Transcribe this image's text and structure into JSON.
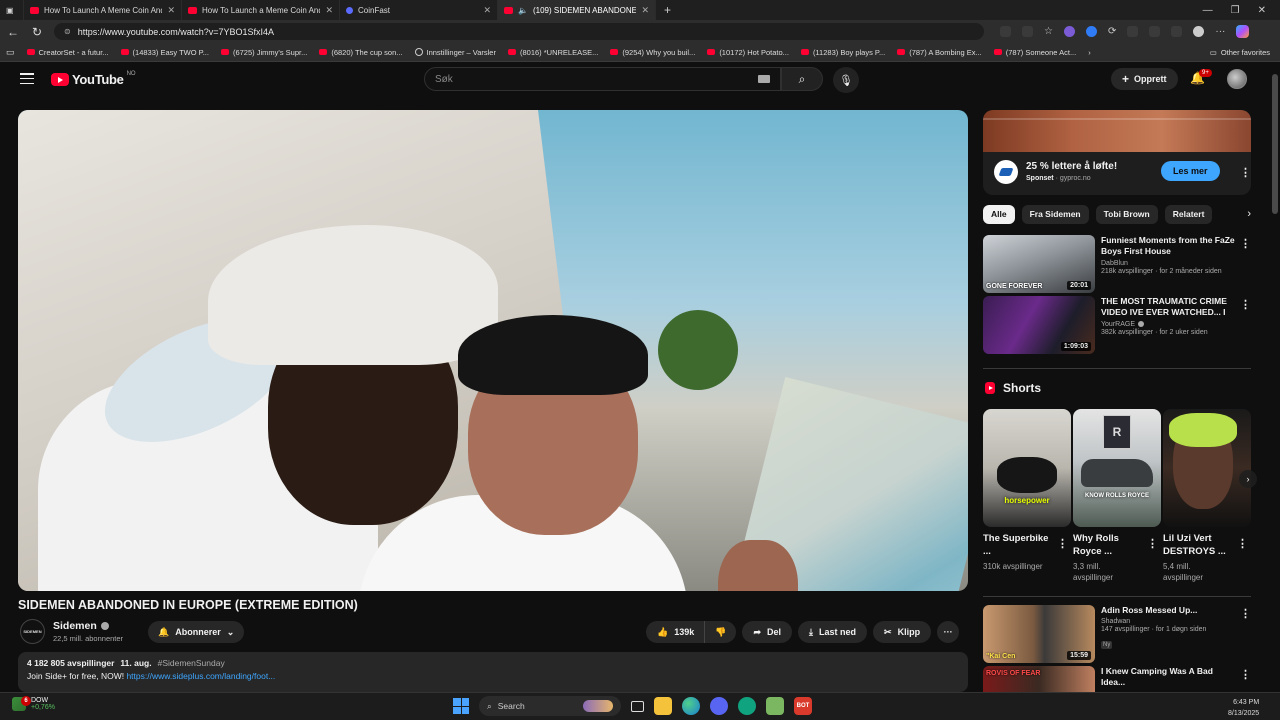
{
  "browser": {
    "tabs": [
      {
        "title": "How To Launch A Meme Coin And",
        "icon": "youtube-icon",
        "active": false
      },
      {
        "title": "How To Launch a Meme Coin And",
        "icon": "youtube-icon",
        "active": false
      },
      {
        "title": "CoinFast",
        "icon": "coinfast-icon",
        "active": false
      },
      {
        "title": "(109) SIDEMEN ABANDONED",
        "icon": "youtube-icon",
        "active": true
      }
    ],
    "url": "https://www.youtube.com/watch?v=7YBO1SfxI4A",
    "bookmarks": [
      "CreatorSet - a futur...",
      "(14833) Easy TWO P...",
      "(6725) Jimmy's Supr...",
      "(6820) The cup son...",
      "Innstillinger – Varsler",
      "(8016) *UNRELEASE...",
      "(9254) Why you buil...",
      "(10172) Hot Potato...",
      "(11283) Boy plays P...",
      "(787) A Bombing Ex...",
      "(787) Someone Act..."
    ],
    "other_favorites": "Other favorites"
  },
  "header": {
    "logo_text": "YouTube",
    "country_code": "NO",
    "search_placeholder": "Søk",
    "create_label": "Opprett",
    "notif_badge": "9+"
  },
  "video": {
    "title": "SIDEMEN ABANDONED IN EUROPE (EXTREME EDITION)",
    "channel": "Sidemen",
    "channel_avatar_text": "SIDEMEN",
    "subscribers": "22,5 mill. abonnenter",
    "subscribe_label": "Abonnerer",
    "likes": "139k",
    "share_label": "Del",
    "download_label": "Last ned",
    "clip_label": "Klipp",
    "views": "4 182 805 avspillinger",
    "date": "11. aug.",
    "hashtag": "#SidemenSunday",
    "desc_text": "Join Side+ for free, NOW!",
    "desc_link": "https://www.sideplus.com/landing/foot..."
  },
  "ad": {
    "title": "25 % lettere å løfte!",
    "sponsored": "Sponset",
    "domain": "gyproc.no",
    "cta": "Les mer"
  },
  "chips": [
    "Alle",
    "Fra Sidemen",
    "Tobi Brown",
    "Relatert"
  ],
  "recommendations": [
    {
      "title": "Funniest Moments from the FaZe Boys First House",
      "channel": "DabBlun",
      "meta": "218k avspillinger · for 2 måneder siden",
      "duration": "20:01",
      "thumb_caption": "GONE FOREVER",
      "verified": false,
      "is_new": false
    },
    {
      "title": "THE MOST TRAUMATIC CRIME VIDEO IVE EVER WATCHED... I",
      "channel": "YourRAGE",
      "meta": "382k avspillinger · for 2 uker siden",
      "duration": "1:09:03",
      "thumb_caption": "",
      "verified": true,
      "is_new": false
    }
  ],
  "shorts": {
    "heading": "Shorts",
    "items": [
      {
        "title": "The Superbike ...",
        "views": "310k avspillinger",
        "caption": "horsepower"
      },
      {
        "title": "Why Rolls Royce ...",
        "views": "3,3 mill. avspillinger",
        "caption": "KNOW ROLLS ROYCE"
      },
      {
        "title": "Lil Uzi Vert DESTROYS ...",
        "views": "5,4 mill. avspillinger",
        "caption": ""
      }
    ]
  },
  "more_recommendations": [
    {
      "title": "Adin Ross Messed Up...",
      "channel": "Shadwan",
      "meta": "147 avspillinger · for 1 døgn siden",
      "duration": "15:59",
      "thumb_caption": "\"Kai Cen",
      "badge": "Ny"
    },
    {
      "title": "I Knew Camping Was A Bad Idea...",
      "channel": "",
      "meta": "",
      "duration": "",
      "thumb_caption": "ROVIS OF FEAR",
      "badge": ""
    }
  ],
  "taskbar": {
    "weather_label": "DOW",
    "weather_change": "+0,76%",
    "notif_count": "6",
    "search_label": "Search",
    "time": "6:43 PM",
    "date": "8/13/2025"
  }
}
